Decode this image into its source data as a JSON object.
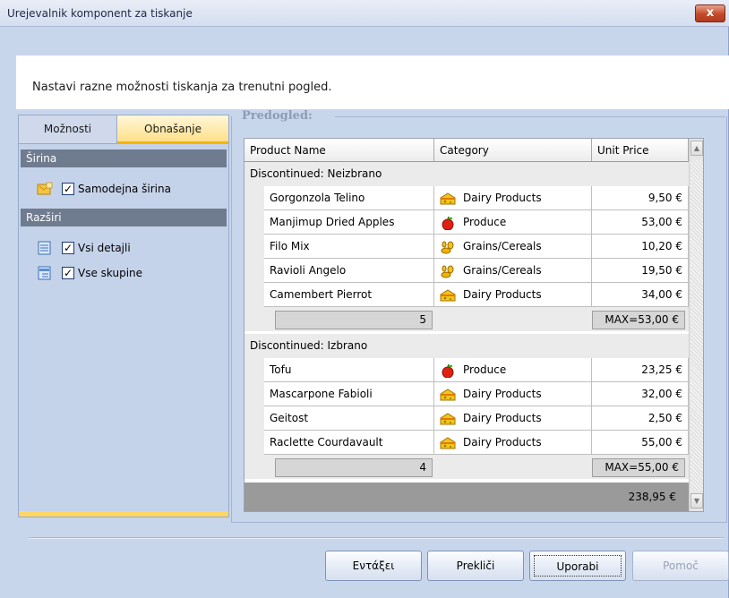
{
  "window": {
    "title": "Urejevalnik komponent za tiskanje",
    "close_label": "x"
  },
  "info": {
    "text": "Nastavi razne možnosti tiskanja za trenutni pogled."
  },
  "tabs": [
    {
      "label": "Možnosti",
      "active": false
    },
    {
      "label": "Obnašanje",
      "active": true
    }
  ],
  "options": {
    "width_header": "Širina",
    "auto_width": {
      "label": "Samodejna širina",
      "checked": "✓"
    },
    "expand_header": "Razširi",
    "all_details": {
      "label": "Vsi detajli",
      "checked": "✓"
    },
    "all_groups": {
      "label": "Vse skupine",
      "checked": "✓"
    }
  },
  "preview": {
    "legend": "Predogled:",
    "columns": [
      "Product Name",
      "Category",
      "Unit Price"
    ],
    "groups": [
      {
        "label": "Discontinued: Neizbrano",
        "rows": [
          {
            "name": "Gorgonzola Telino",
            "category": "Dairy Products",
            "icon": "cheese-icon",
            "price": "9,50 €"
          },
          {
            "name": "Manjimup Dried Apples",
            "category": "Produce",
            "icon": "apple-icon",
            "price": "53,00 €"
          },
          {
            "name": "Filo Mix",
            "category": "Grains/Cereals",
            "icon": "grain-icon",
            "price": "10,20 €"
          },
          {
            "name": "Ravioli Angelo",
            "category": "Grains/Cereals",
            "icon": "grain-icon",
            "price": "19,50 €"
          },
          {
            "name": "Camembert Pierrot",
            "category": "Dairy Products",
            "icon": "cheese-icon",
            "price": "34,00 €"
          }
        ],
        "count": "5",
        "max": "MAX=53,00 €"
      },
      {
        "label": "Discontinued: Izbrano",
        "rows": [
          {
            "name": "Tofu",
            "category": "Produce",
            "icon": "apple-icon",
            "price": "23,25 €"
          },
          {
            "name": "Mascarpone Fabioli",
            "category": "Dairy Products",
            "icon": "cheese-icon",
            "price": "32,00 €"
          },
          {
            "name": "Geitost",
            "category": "Dairy Products",
            "icon": "cheese-icon",
            "price": "2,50 €"
          },
          {
            "name": "Raclette Courdavault",
            "category": "Dairy Products",
            "icon": "cheese-icon",
            "price": "55,00 €"
          }
        ],
        "count": "4",
        "max": "MAX=55,00 €"
      }
    ],
    "total": "238,95 €"
  },
  "buttons": {
    "apply_left": "Εντάξει",
    "cancel": "Prekliči",
    "apply": "Uporabi",
    "help": "Pomoč"
  },
  "colors": {
    "tab_active": "#ffe08a",
    "section_header": "#6f7b8e",
    "total_row": "#9a9a9a"
  }
}
